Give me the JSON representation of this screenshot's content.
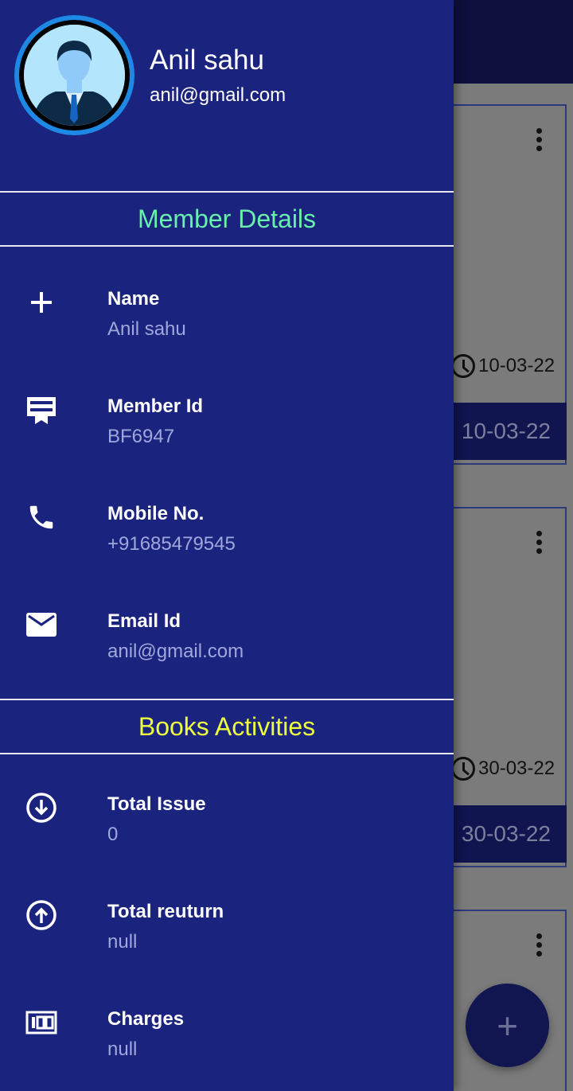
{
  "drawer": {
    "profile": {
      "name": "Anil sahu",
      "email": "anil@gmail.com"
    },
    "member_section": {
      "title": "Member Details",
      "items": [
        {
          "icon": "plus-icon",
          "label": "Name",
          "value": "Anil sahu"
        },
        {
          "icon": "card-membership-icon",
          "label": "Member Id",
          "value": "BF6947"
        },
        {
          "icon": "phone-icon",
          "label": "Mobile No.",
          "value": "+91685479545"
        },
        {
          "icon": "email-icon",
          "label": "Email Id",
          "value": "anil@gmail.com"
        }
      ]
    },
    "books_section": {
      "title": "Books Activities",
      "items": [
        {
          "icon": "arrow-down-circle-icon",
          "label": "Total Issue",
          "value": "0"
        },
        {
          "icon": "arrow-up-circle-icon",
          "label": "Total reuturn",
          "value": "null"
        },
        {
          "icon": "charges-icon",
          "label": "Charges",
          "value": "null"
        }
      ]
    }
  },
  "background": {
    "cards": [
      {
        "date": "10-03-22",
        "bar_date": "10-03-22"
      },
      {
        "date": "30-03-22",
        "bar_date": "30-03-22"
      },
      {
        "date": "",
        "bar_date": ""
      }
    ],
    "fab_label": "+"
  },
  "colors": {
    "drawer_bg": "#1a237e",
    "member_title": "#69f0ae",
    "books_title": "#eeff41",
    "value_text": "#9fa8da"
  }
}
